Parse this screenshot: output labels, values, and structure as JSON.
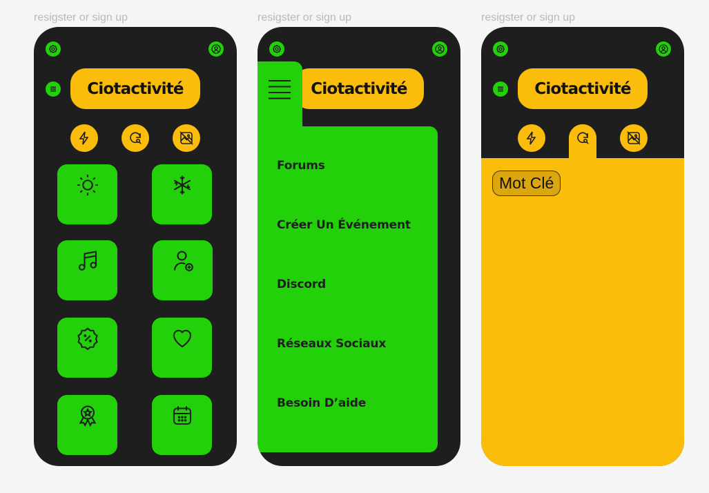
{
  "screens": [
    {
      "caption": "resigster or sign up",
      "brand": "Ciotactivité",
      "icons": {
        "settings": "gear-icon",
        "profile": "user-circle-icon",
        "menu": "hamburger-icon"
      },
      "categories": [
        "bolt-icon",
        "refresh-search-icon",
        "image-off-icon"
      ],
      "tiles": [
        "sun-icon",
        "snowflake-icon",
        "music-note-icon",
        "user-add-icon",
        "discount-badge-icon",
        "heart-icon",
        "award-icon",
        "calendar-icon"
      ]
    },
    {
      "caption": "resigster or sign up",
      "brand": "Ciotactivité",
      "menu": [
        "Forums",
        "Créer Un Événement",
        "Discord",
        "Réseaux Sociaux",
        "Besoin D’aide"
      ]
    },
    {
      "caption": "resigster or sign up",
      "brand": "Ciotactivité",
      "chip": "Mot Clé",
      "active_category": "refresh-search-icon"
    }
  ],
  "colors": {
    "background": "#f5f5f5",
    "phone": "#1e1e1e",
    "green": "#22d10a",
    "yellow": "#fbbd0b"
  }
}
